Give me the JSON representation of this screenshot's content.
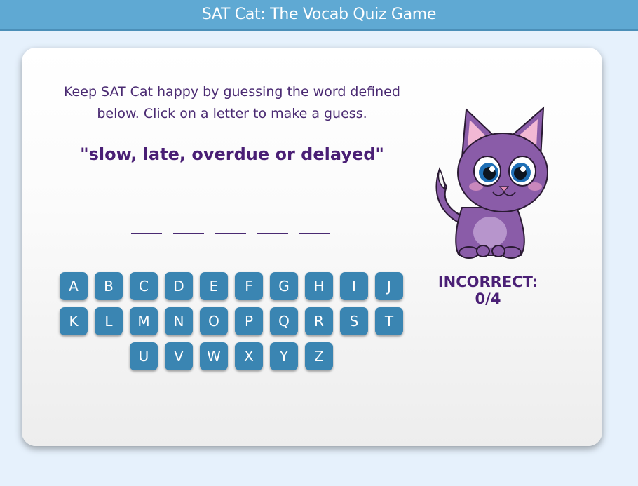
{
  "header": {
    "title": "SAT Cat: The Vocab Quiz Game"
  },
  "game": {
    "instructions": "Keep SAT Cat happy by guessing the word defined below. Click on a letter to make a guess.",
    "definition": "\"slow, late, overdue or delayed\"",
    "blank_count": 5,
    "incorrect_label": "INCORRECT: 0/4"
  },
  "keyboard": {
    "row1": [
      "A",
      "B",
      "C",
      "D",
      "E",
      "F",
      "G",
      "H",
      "I",
      "J"
    ],
    "row2": [
      "K",
      "L",
      "M",
      "N",
      "O",
      "P",
      "Q",
      "R",
      "S",
      "T"
    ],
    "row3": [
      "U",
      "V",
      "W",
      "X",
      "Y",
      "Z"
    ]
  },
  "mascot": {
    "icon": "purple-cat-illustration"
  },
  "colors": {
    "header": "#5fa9d3",
    "key": "#3a85b2",
    "text": "#4a1f75",
    "cat": "#8a5ca8"
  }
}
